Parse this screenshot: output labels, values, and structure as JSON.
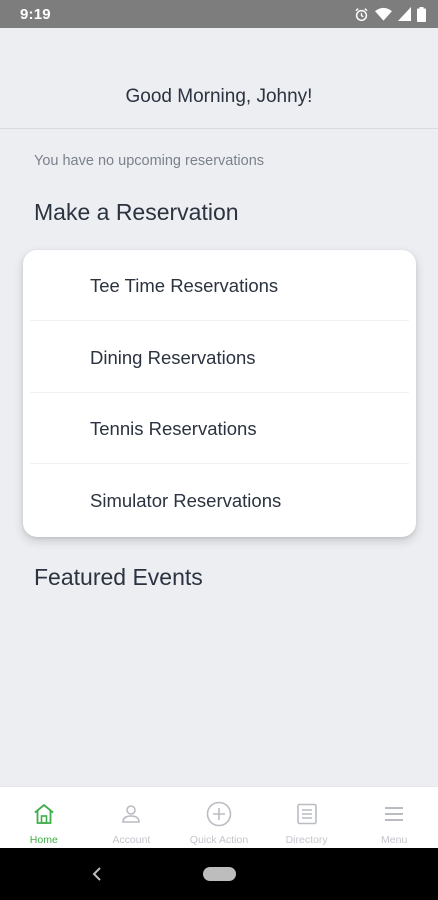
{
  "status_bar": {
    "time": "9:19",
    "icons": [
      "alarm-icon",
      "wifi-icon",
      "signal-icon",
      "battery-icon"
    ]
  },
  "header": {
    "greeting": "Good Morning, Johny!"
  },
  "reservations": {
    "empty_message": "You have no upcoming reservations"
  },
  "make_reservation": {
    "title": "Make a Reservation",
    "items": [
      {
        "label": "Tee Time Reservations"
      },
      {
        "label": "Dining Reservations"
      },
      {
        "label": "Tennis Reservations"
      },
      {
        "label": "Simulator Reservations"
      }
    ]
  },
  "featured_events": {
    "title": "Featured Events"
  },
  "bottom_nav": {
    "items": [
      {
        "label": "Home",
        "icon": "home-icon",
        "active": true
      },
      {
        "label": "Account",
        "icon": "user-icon",
        "active": false
      },
      {
        "label": "Quick Action",
        "icon": "plus-circle-icon",
        "active": false
      },
      {
        "label": "Directory",
        "icon": "list-icon",
        "active": false
      },
      {
        "label": "Menu",
        "icon": "hamburger-icon",
        "active": false
      }
    ]
  },
  "colors": {
    "accent": "#3fae49",
    "background": "#eceef2",
    "text": "#2b3340",
    "muted_text": "#7b818c",
    "inactive_nav": "#c3c6cc"
  }
}
